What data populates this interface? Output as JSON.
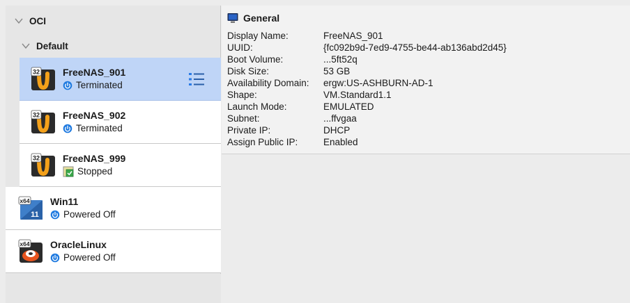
{
  "sidebar": {
    "groups": [
      {
        "label": "OCI"
      },
      {
        "label": "Default"
      }
    ],
    "vms": [
      {
        "name": "FreeNAS_901",
        "state": "Terminated",
        "badge": "32"
      },
      {
        "name": "FreeNAS_902",
        "state": "Terminated",
        "badge": "32"
      },
      {
        "name": "FreeNAS_999",
        "state": "Stopped",
        "badge": "32"
      },
      {
        "name": "Win11",
        "state": "Powered Off",
        "badge": "x64",
        "sub_badge": "11"
      },
      {
        "name": "OracleLinux",
        "state": "Powered Off",
        "badge": "x64"
      }
    ]
  },
  "details": {
    "title": "General",
    "rows": [
      {
        "key": "Display Name:",
        "value": "FreeNAS_901"
      },
      {
        "key": "UUID:",
        "value": "{fc092b9d-7ed9-4755-be44-ab136abd2d45}"
      },
      {
        "key": "Boot Volume:",
        "value": "...5ft52q"
      },
      {
        "key": "Disk Size:",
        "value": "53 GB"
      },
      {
        "key": "Availability Domain:",
        "value": "ergw:US-ASHBURN-AD-1"
      },
      {
        "key": "Shape:",
        "value": "VM.Standard1.1"
      },
      {
        "key": "Launch Mode:",
        "value": "EMULATED"
      },
      {
        "key": "Subnet:",
        "value": "...ffvgaa"
      },
      {
        "key": "Private IP:",
        "value": "DHCP"
      },
      {
        "key": "Assign Public IP:",
        "value": "Enabled"
      }
    ]
  },
  "colors": {
    "selected_row": "#bfd5f7",
    "power_icon": "#1f7ae0",
    "monitor_icon": "#2a63c6"
  }
}
